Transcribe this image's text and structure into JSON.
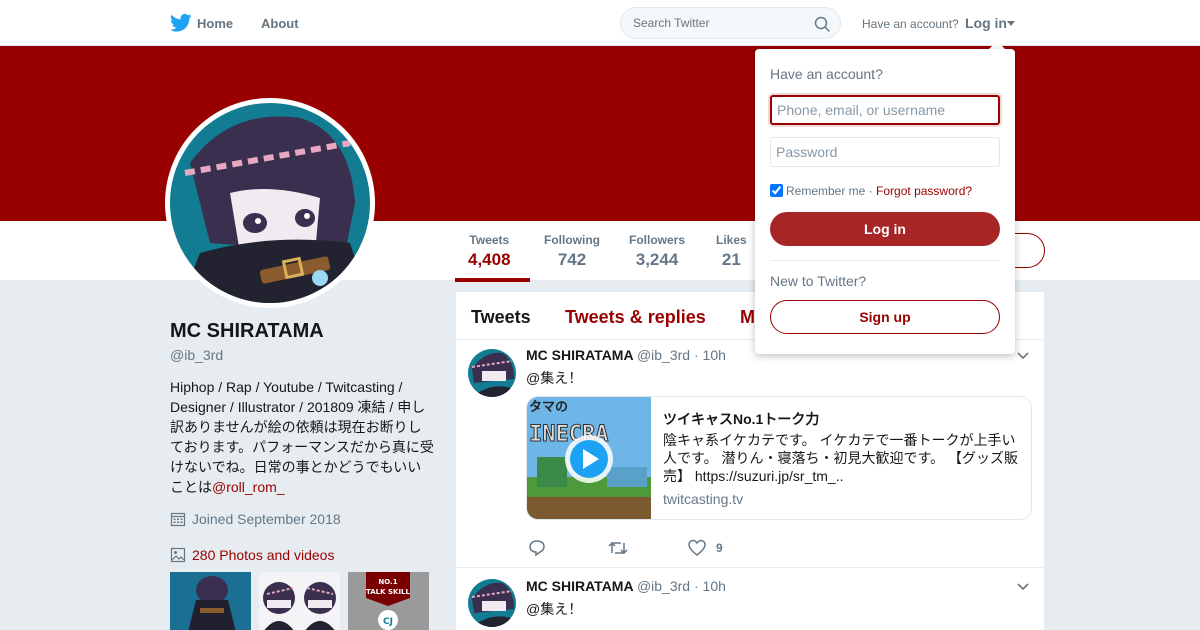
{
  "nav": {
    "home_label": "Home",
    "about_label": "About",
    "search_placeholder": "Search Twitter",
    "have_account": "Have an account?",
    "login_label": "Log in"
  },
  "colors": {
    "theme": "#990000",
    "twitter_blue": "#1da1f2"
  },
  "profile_nav": {
    "stats": [
      {
        "label": "Tweets",
        "value": "4,408",
        "active": true
      },
      {
        "label": "Following",
        "value": "742"
      },
      {
        "label": "Followers",
        "value": "3,244"
      },
      {
        "label": "Likes",
        "value": "21"
      }
    ]
  },
  "profile": {
    "name": "MC SHIRATAMA",
    "handle": "@ib_3rd",
    "bio": "Hiphop / Rap / Youtube / Twitcasting / Designer / Illustrator / 201809 凍結 / 申し訳ありませんが絵の依頼は現在お断りしております。パフォーマンスだから真に受けないでね。日常の事とかどうでもいいことは",
    "bio_mention": "@roll_rom_",
    "joined": "Joined September 2018",
    "photos": "280 Photos and videos",
    "thumb3_text_line1": "NO.1",
    "thumb3_text_line2": "TALK SKILL",
    "thumb3_logo": "CJ"
  },
  "timeline": {
    "tabs": [
      "Tweets",
      "Tweets & replies",
      "M"
    ],
    "tweets": [
      {
        "name": "MC SHIRATAMA",
        "handle": "@ib_3rd",
        "dot": "·",
        "time": "10h",
        "text": "@集え！",
        "card": {
          "title": "ツイキャスNo.1トーク力",
          "description": "陰キャ系イケカテです。 イケカテで一番トークが上手い人です。 潜りん・寝落ち・初見大歓迎です。 【グッズ販売】 https://suzuri.jp/sr_tm_..",
          "domain": "twitcasting.tv",
          "image_text": "タマの",
          "image_text2": "INECRA"
        },
        "like_count": "9"
      },
      {
        "name": "MC SHIRATAMA",
        "handle": "@ib_3rd",
        "dot": "·",
        "time": "10h",
        "text": "@集え！"
      }
    ]
  },
  "login_dropdown": {
    "title": "Have an account?",
    "username_placeholder": "Phone, email, or username",
    "password_placeholder": "Password",
    "remember_me": "Remember me",
    "separator": "·",
    "forgot_password": "Forgot password?",
    "login_button": "Log in",
    "new_to_twitter": "New to Twitter?",
    "signup_button": "Sign up"
  }
}
